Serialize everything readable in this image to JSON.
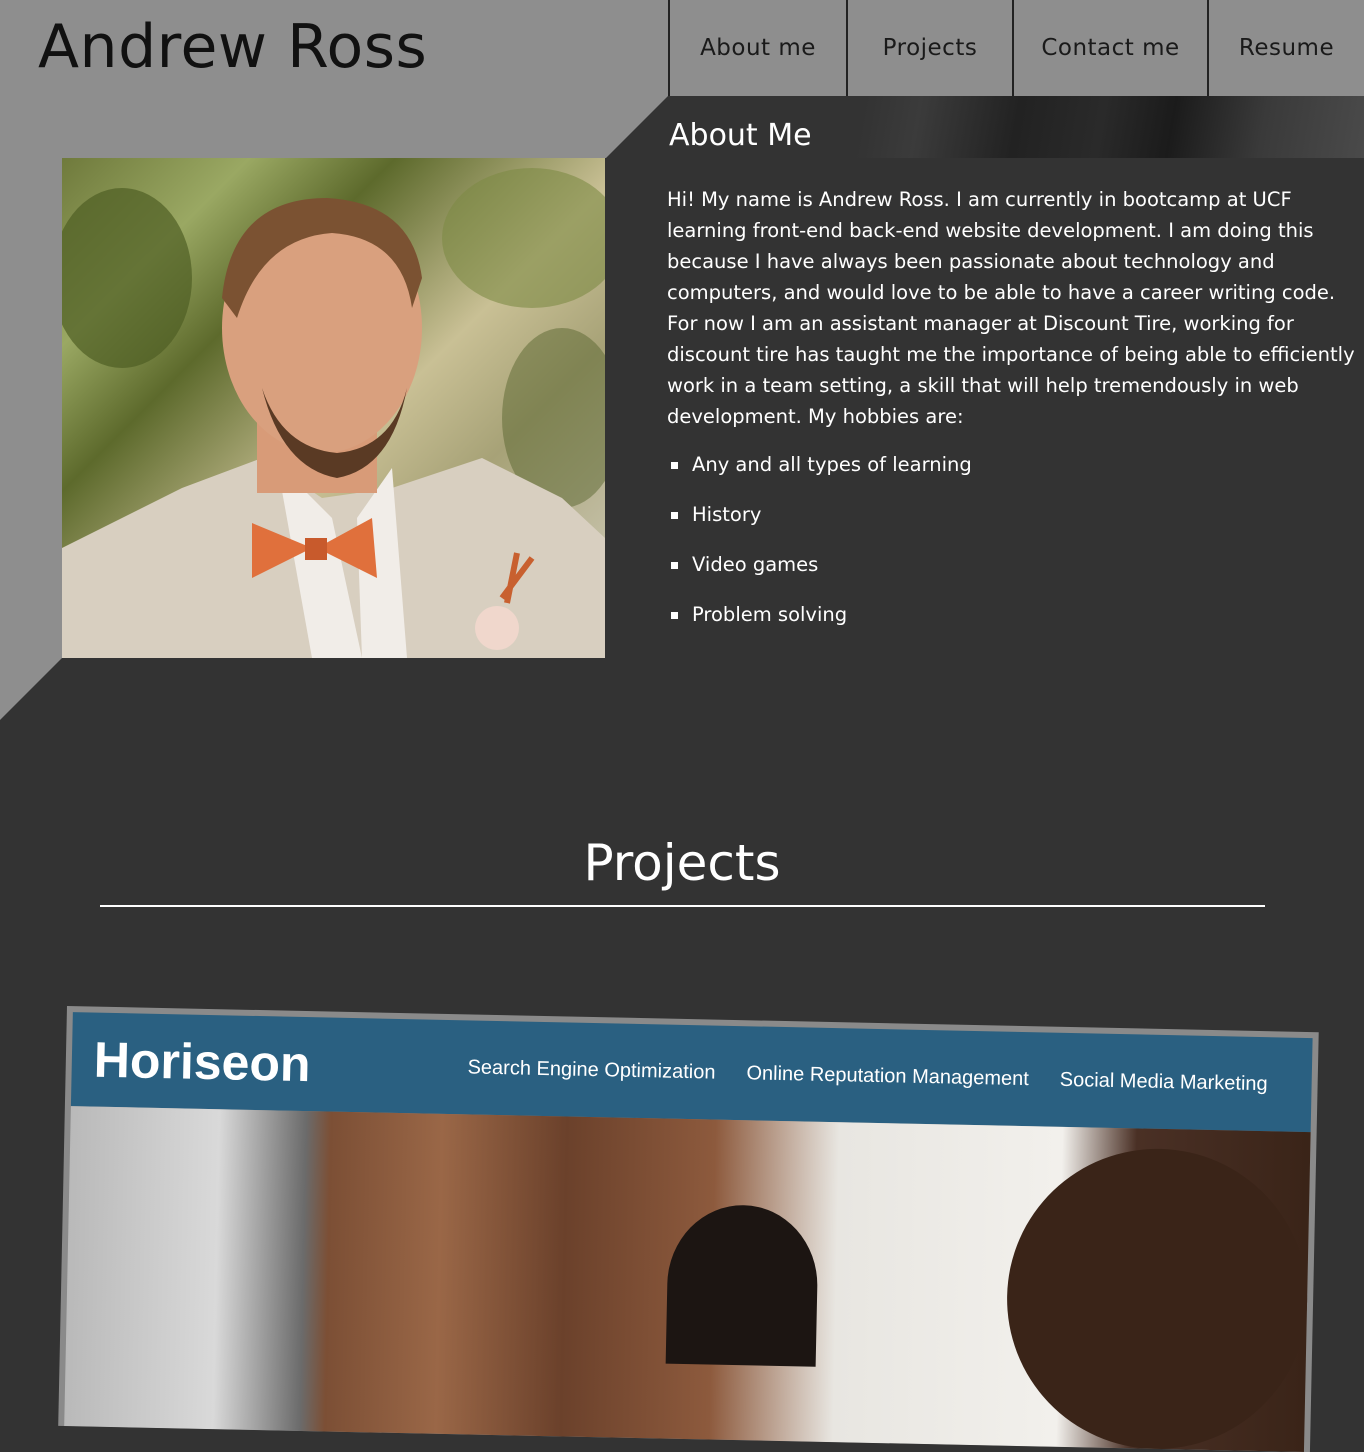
{
  "header": {
    "title": "Andrew Ross",
    "nav": [
      "About me",
      "Projects",
      "Contact me",
      "Resume"
    ]
  },
  "about": {
    "heading": "About Me",
    "photo_alt": "Portrait of Andrew Ross",
    "bio": "Hi! My name is Andrew Ross. I am currently in bootcamp at UCF learning front-end back-end website development. I am doing this because I have always been passionate about technology and computers, and would love to be able to have a career writing code. For now I am an assistant manager at Discount Tire, working for discount tire has taught me the importance of being able to efficiently work in a team setting, a skill that will help tremendously in web development. My hobbies are:",
    "hobbies": [
      "Any and all types of learning",
      "History",
      "Video games",
      "Problem solving"
    ]
  },
  "projects": {
    "heading": "Projects",
    "items": [
      {
        "logo": "Horiseon",
        "nav": [
          "Search Engine Optimization",
          "Online Reputation Management",
          "Social Media Marketing"
        ]
      }
    ]
  },
  "colors": {
    "page_bg": "#333333",
    "header_bg": "#8e8e8e",
    "project_header_bg": "#2a6081"
  }
}
